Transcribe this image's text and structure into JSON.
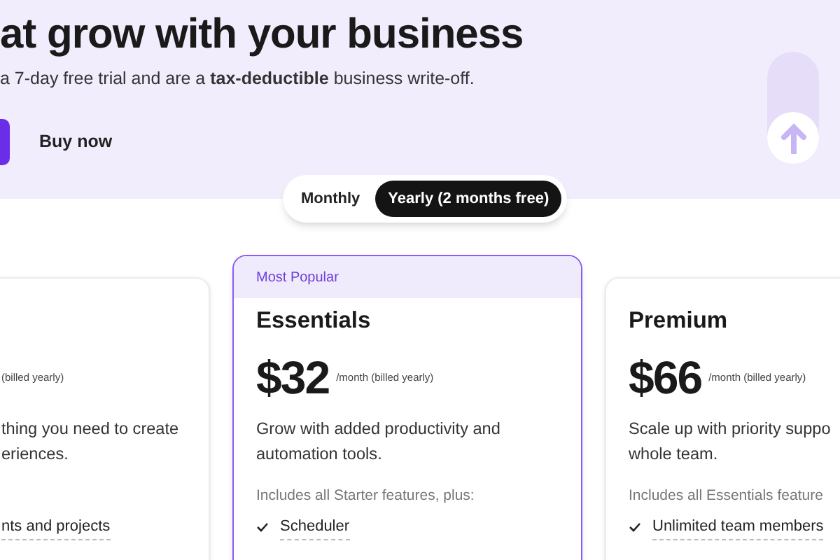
{
  "hero": {
    "heading": "at grow with your business",
    "subtitle": "a 7-day free trial and are a **tax-deductible** business write-off.",
    "buy_now": "Buy now"
  },
  "billing_toggle": [
    {
      "label": "Monthly",
      "selected": false
    },
    {
      "label": "Yearly (2 months free)",
      "selected": true
    }
  ],
  "plans": [
    {
      "highlighted": false,
      "period": "(billed yearly)",
      "description_lines": [
        "thing you need to create",
        "eriences."
      ],
      "features": [
        "nts and projects"
      ]
    },
    {
      "highlighted": true,
      "badge": "Most Popular",
      "name": "Essentials",
      "price": "$32",
      "period": "/month (billed yearly)",
      "description_lines": [
        "Grow with added productivity and",
        "automation tools."
      ],
      "includes": "Includes all Starter features, plus:",
      "features": [
        "Scheduler"
      ]
    },
    {
      "highlighted": false,
      "name": "Premium",
      "price": "$66",
      "period": "/month (billed yearly)",
      "description_lines": [
        "Scale up with priority suppo",
        "whole team."
      ],
      "includes": "Includes all Essentials feature",
      "features": [
        "Unlimited team members"
      ]
    }
  ]
}
